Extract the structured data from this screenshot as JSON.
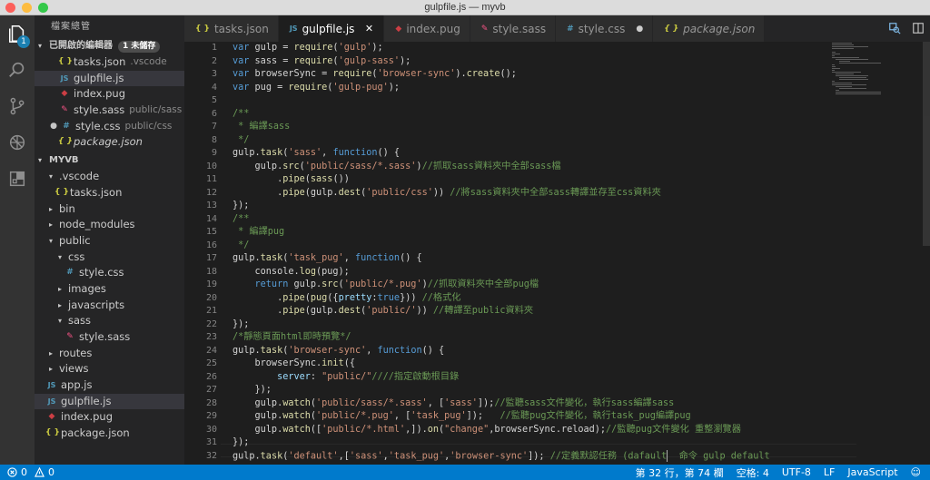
{
  "window": {
    "title": "gulpfile.js — myvb"
  },
  "activity": {
    "explorer_badge": "1"
  },
  "sidebar": {
    "title": "檔案總管",
    "open_editors": {
      "label": "已開啟的編輯器",
      "badge": "1 未儲存",
      "items": [
        {
          "icon": "{ }",
          "name": "tasks.json",
          "desc": ".vscode"
        },
        {
          "icon": "JS",
          "name": "gulpfile.js",
          "desc": ""
        },
        {
          "icon": "◆",
          "name": "index.pug",
          "desc": ""
        },
        {
          "icon": "✎",
          "name": "style.sass",
          "desc": "public/sass"
        },
        {
          "icon": "#",
          "name": "style.css",
          "desc": "public/css"
        },
        {
          "icon": "{ }",
          "name": "package.json",
          "desc": ""
        }
      ]
    },
    "project": {
      "label": "MYVB",
      "items": [
        {
          "tw": "▾",
          "icon": "",
          "name": ".vscode"
        },
        {
          "tw": "",
          "icon": "{ }",
          "name": "tasks.json"
        },
        {
          "tw": "▸",
          "icon": "",
          "name": "bin"
        },
        {
          "tw": "▸",
          "icon": "",
          "name": "node_modules"
        },
        {
          "tw": "▾",
          "icon": "",
          "name": "public"
        },
        {
          "tw": "▾",
          "icon": "",
          "name": "css"
        },
        {
          "tw": "",
          "icon": "#",
          "name": "style.css"
        },
        {
          "tw": "▸",
          "icon": "",
          "name": "images"
        },
        {
          "tw": "▸",
          "icon": "",
          "name": "javascripts"
        },
        {
          "tw": "▾",
          "icon": "",
          "name": "sass"
        },
        {
          "tw": "",
          "icon": "✎",
          "name": "style.sass"
        },
        {
          "tw": "▸",
          "icon": "",
          "name": "routes"
        },
        {
          "tw": "▸",
          "icon": "",
          "name": "views"
        },
        {
          "tw": "",
          "icon": "JS",
          "name": "app.js"
        },
        {
          "tw": "",
          "icon": "JS",
          "name": "gulpfile.js"
        },
        {
          "tw": "",
          "icon": "◆",
          "name": "index.pug"
        },
        {
          "tw": "",
          "icon": "{ }",
          "name": "package.json"
        }
      ]
    }
  },
  "tabs": [
    {
      "icon": "{ }",
      "label": "tasks.json"
    },
    {
      "icon": "JS",
      "label": "gulpfile.js",
      "active": true,
      "close": "✕"
    },
    {
      "icon": "◆",
      "label": "index.pug"
    },
    {
      "icon": "✎",
      "label": "style.sass"
    },
    {
      "icon": "#",
      "label": "style.css",
      "modified": "●"
    },
    {
      "icon": "{ }",
      "label": "package.json"
    }
  ],
  "editor": {
    "line_numbers": [
      "1",
      "2",
      "3",
      "4",
      "5",
      "6",
      "7",
      "8",
      "9",
      "10",
      "11",
      "12",
      "13",
      "14",
      "15",
      "16",
      "17",
      "18",
      "19",
      "20",
      "21",
      "22",
      "23",
      "24",
      "25",
      "26",
      "27",
      "28",
      "29",
      "30",
      "31",
      "32"
    ]
  },
  "status": {
    "errors": "0",
    "warnings": "0",
    "position": "第 32 行，第 74 欄",
    "spaces": "空格: 4",
    "encoding": "UTF-8",
    "eol": "LF",
    "language": "JavaScript"
  },
  "colors": {
    "status_bar": "#007acc",
    "activity_bar": "#333333",
    "sidebar": "#252526",
    "editor": "#1e1e1e"
  }
}
